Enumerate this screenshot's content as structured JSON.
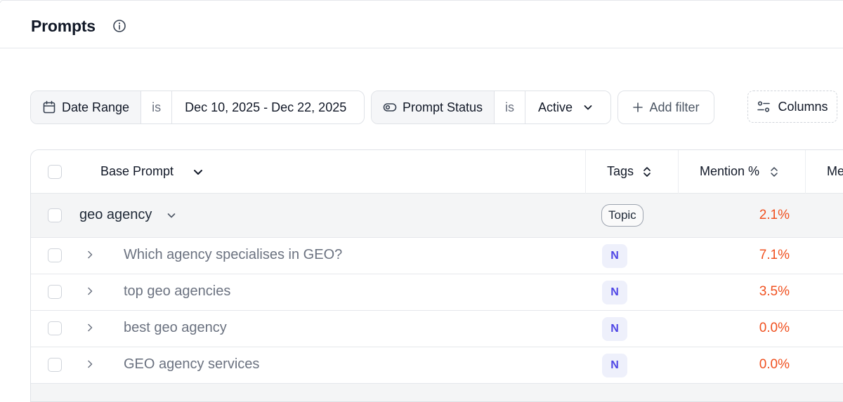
{
  "header": {
    "title": "Prompts",
    "info_icon": "info-circle-icon"
  },
  "filters": [
    {
      "field": "Date Range",
      "icon": "calendar-icon",
      "operator": "is",
      "value": "Dec 10, 2025 - Dec 22, 2025"
    },
    {
      "field": "Prompt Status",
      "icon": "toggle-icon",
      "operator": "is",
      "value": "Active",
      "dropdown_icon": "chevron-down-icon"
    }
  ],
  "add_filter_label": "Add filter",
  "columns_label": "Columns",
  "table": {
    "columns": [
      {
        "label": "Base Prompt",
        "icon": "chevron-down-icon"
      },
      {
        "label": "Tags",
        "icon": "sort-icon"
      },
      {
        "label": "Mention %",
        "icon": "sort-icon"
      },
      {
        "label": "Me"
      }
    ],
    "group": {
      "label": "geo agency",
      "tag": "Topic",
      "mention": "2.1%"
    },
    "rows": [
      {
        "prompt": "Which agency specialises in GEO?",
        "tag": "N",
        "mention": "7.1%"
      },
      {
        "prompt": "top geo agencies",
        "tag": "N",
        "mention": "3.5%"
      },
      {
        "prompt": "best geo agency",
        "tag": "N",
        "mention": "0.0%"
      },
      {
        "prompt": "GEO agency services",
        "tag": "N",
        "mention": "0.0%"
      }
    ]
  },
  "colors": {
    "accent_orange": "#f0501f",
    "badge_indigo": "#4f46e5",
    "badge_bg": "#eef0fb"
  }
}
